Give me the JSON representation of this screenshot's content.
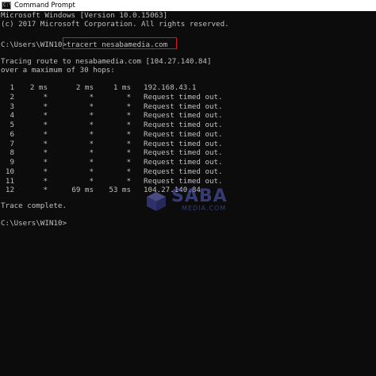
{
  "window": {
    "title": "Command Prompt",
    "icon": "cmd-icon",
    "icon_glyph": "C:\\"
  },
  "console": {
    "header_lines": [
      "Microsoft Windows [Version 10.0.15063]",
      "(c) 2017 Microsoft Corporation. All rights reserved."
    ],
    "prompt": "C:\\Users\\WIN10>",
    "command": "tracert nesabamedia.com",
    "tracing_line": "Tracing route to nesabamedia.com [104.27.140.84]",
    "max_hops_line": "over a maximum of 30 hops:",
    "hops": [
      {
        "num": "1",
        "t1": "2 ms",
        "t2": "2 ms",
        "t3": "1 ms",
        "host": "192.168.43.1"
      },
      {
        "num": "2",
        "t1": "*",
        "t2": "*",
        "t3": "*",
        "host": "Request timed out."
      },
      {
        "num": "3",
        "t1": "*",
        "t2": "*",
        "t3": "*",
        "host": "Request timed out."
      },
      {
        "num": "4",
        "t1": "*",
        "t2": "*",
        "t3": "*",
        "host": "Request timed out."
      },
      {
        "num": "5",
        "t1": "*",
        "t2": "*",
        "t3": "*",
        "host": "Request timed out."
      },
      {
        "num": "6",
        "t1": "*",
        "t2": "*",
        "t3": "*",
        "host": "Request timed out."
      },
      {
        "num": "7",
        "t1": "*",
        "t2": "*",
        "t3": "*",
        "host": "Request timed out."
      },
      {
        "num": "8",
        "t1": "*",
        "t2": "*",
        "t3": "*",
        "host": "Request timed out."
      },
      {
        "num": "9",
        "t1": "*",
        "t2": "*",
        "t3": "*",
        "host": "Request timed out."
      },
      {
        "num": "10",
        "t1": "*",
        "t2": "*",
        "t3": "*",
        "host": "Request timed out."
      },
      {
        "num": "11",
        "t1": "*",
        "t2": "*",
        "t3": "*",
        "host": "Request timed out."
      },
      {
        "num": "12",
        "t1": "*",
        "t2": "69 ms",
        "t3": "53 ms",
        "host": "104.27.140.84"
      }
    ],
    "complete_line": "Trace complete.",
    "final_prompt": "C:\\Users\\WIN10>"
  },
  "watermark": {
    "brand": "NESABA",
    "brand_visible": "SABA",
    "sub": "MEDIA.COM"
  },
  "colors": {
    "background": "#0c0c0c",
    "text": "#c0c0c0",
    "highlight_border": "#e0141e",
    "watermark": "#5a62c8"
  }
}
